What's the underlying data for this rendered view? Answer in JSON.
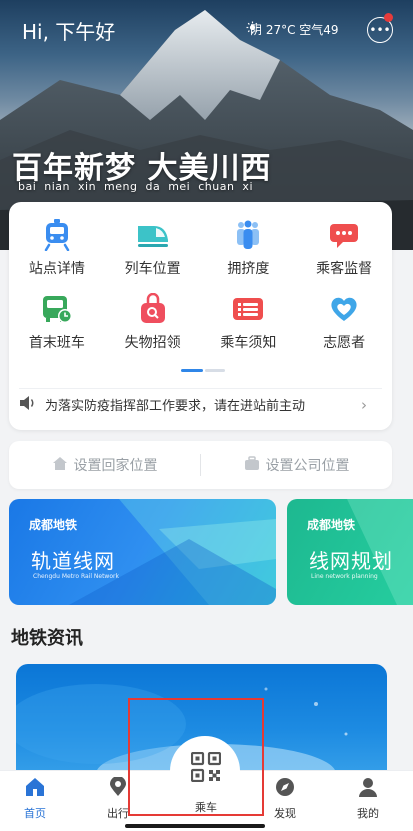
{
  "header": {
    "greeting": "Hi, 下午好",
    "weather": "阴 27°C 空气49",
    "slogan": "百年新梦  大美川西",
    "pinyin": "bai nian xin meng da mei chuan xi"
  },
  "functions": [
    {
      "label": "站点详情",
      "icon": "metro-train-icon",
      "color": "#3a8df0"
    },
    {
      "label": "列车位置",
      "icon": "bullet-train-icon",
      "color": "#3cc3c8"
    },
    {
      "label": "拥挤度",
      "icon": "crowd-people-icon",
      "color": "#4d9ef2"
    },
    {
      "label": "乘客监督",
      "icon": "feedback-chat-icon",
      "color": "#ef4e4e"
    },
    {
      "label": "首末班车",
      "icon": "bus-clock-icon",
      "color": "#38a85b"
    },
    {
      "label": "失物招领",
      "icon": "lost-bag-icon",
      "color": "#ef4e5e"
    },
    {
      "label": "乘车须知",
      "icon": "notice-list-icon",
      "color": "#ef4e4e"
    },
    {
      "label": "志愿者",
      "icon": "heart-volunteer-icon",
      "color": "#3fa6e8"
    }
  ],
  "notice": {
    "text": "为落实防疫指挥部工作要求，请在进站前主动"
  },
  "location": {
    "home_label": "设置回家位置",
    "company_label": "设置公司位置"
  },
  "banners": [
    {
      "tag": "成都地铁",
      "title": "轨道线网",
      "subtitle": "Chengdu Metro Rail Network",
      "color": "#1f7fe8"
    },
    {
      "tag": "成都地铁",
      "title": "线网规划",
      "subtitle": "Line network planning",
      "color": "#22c297"
    }
  ],
  "news": {
    "title": "地铁资讯"
  },
  "tabbar": {
    "home": "首页",
    "travel": "出行",
    "ride": "乘车",
    "discover": "发现",
    "mine": "我的",
    "active_color": "#2a74d6"
  }
}
